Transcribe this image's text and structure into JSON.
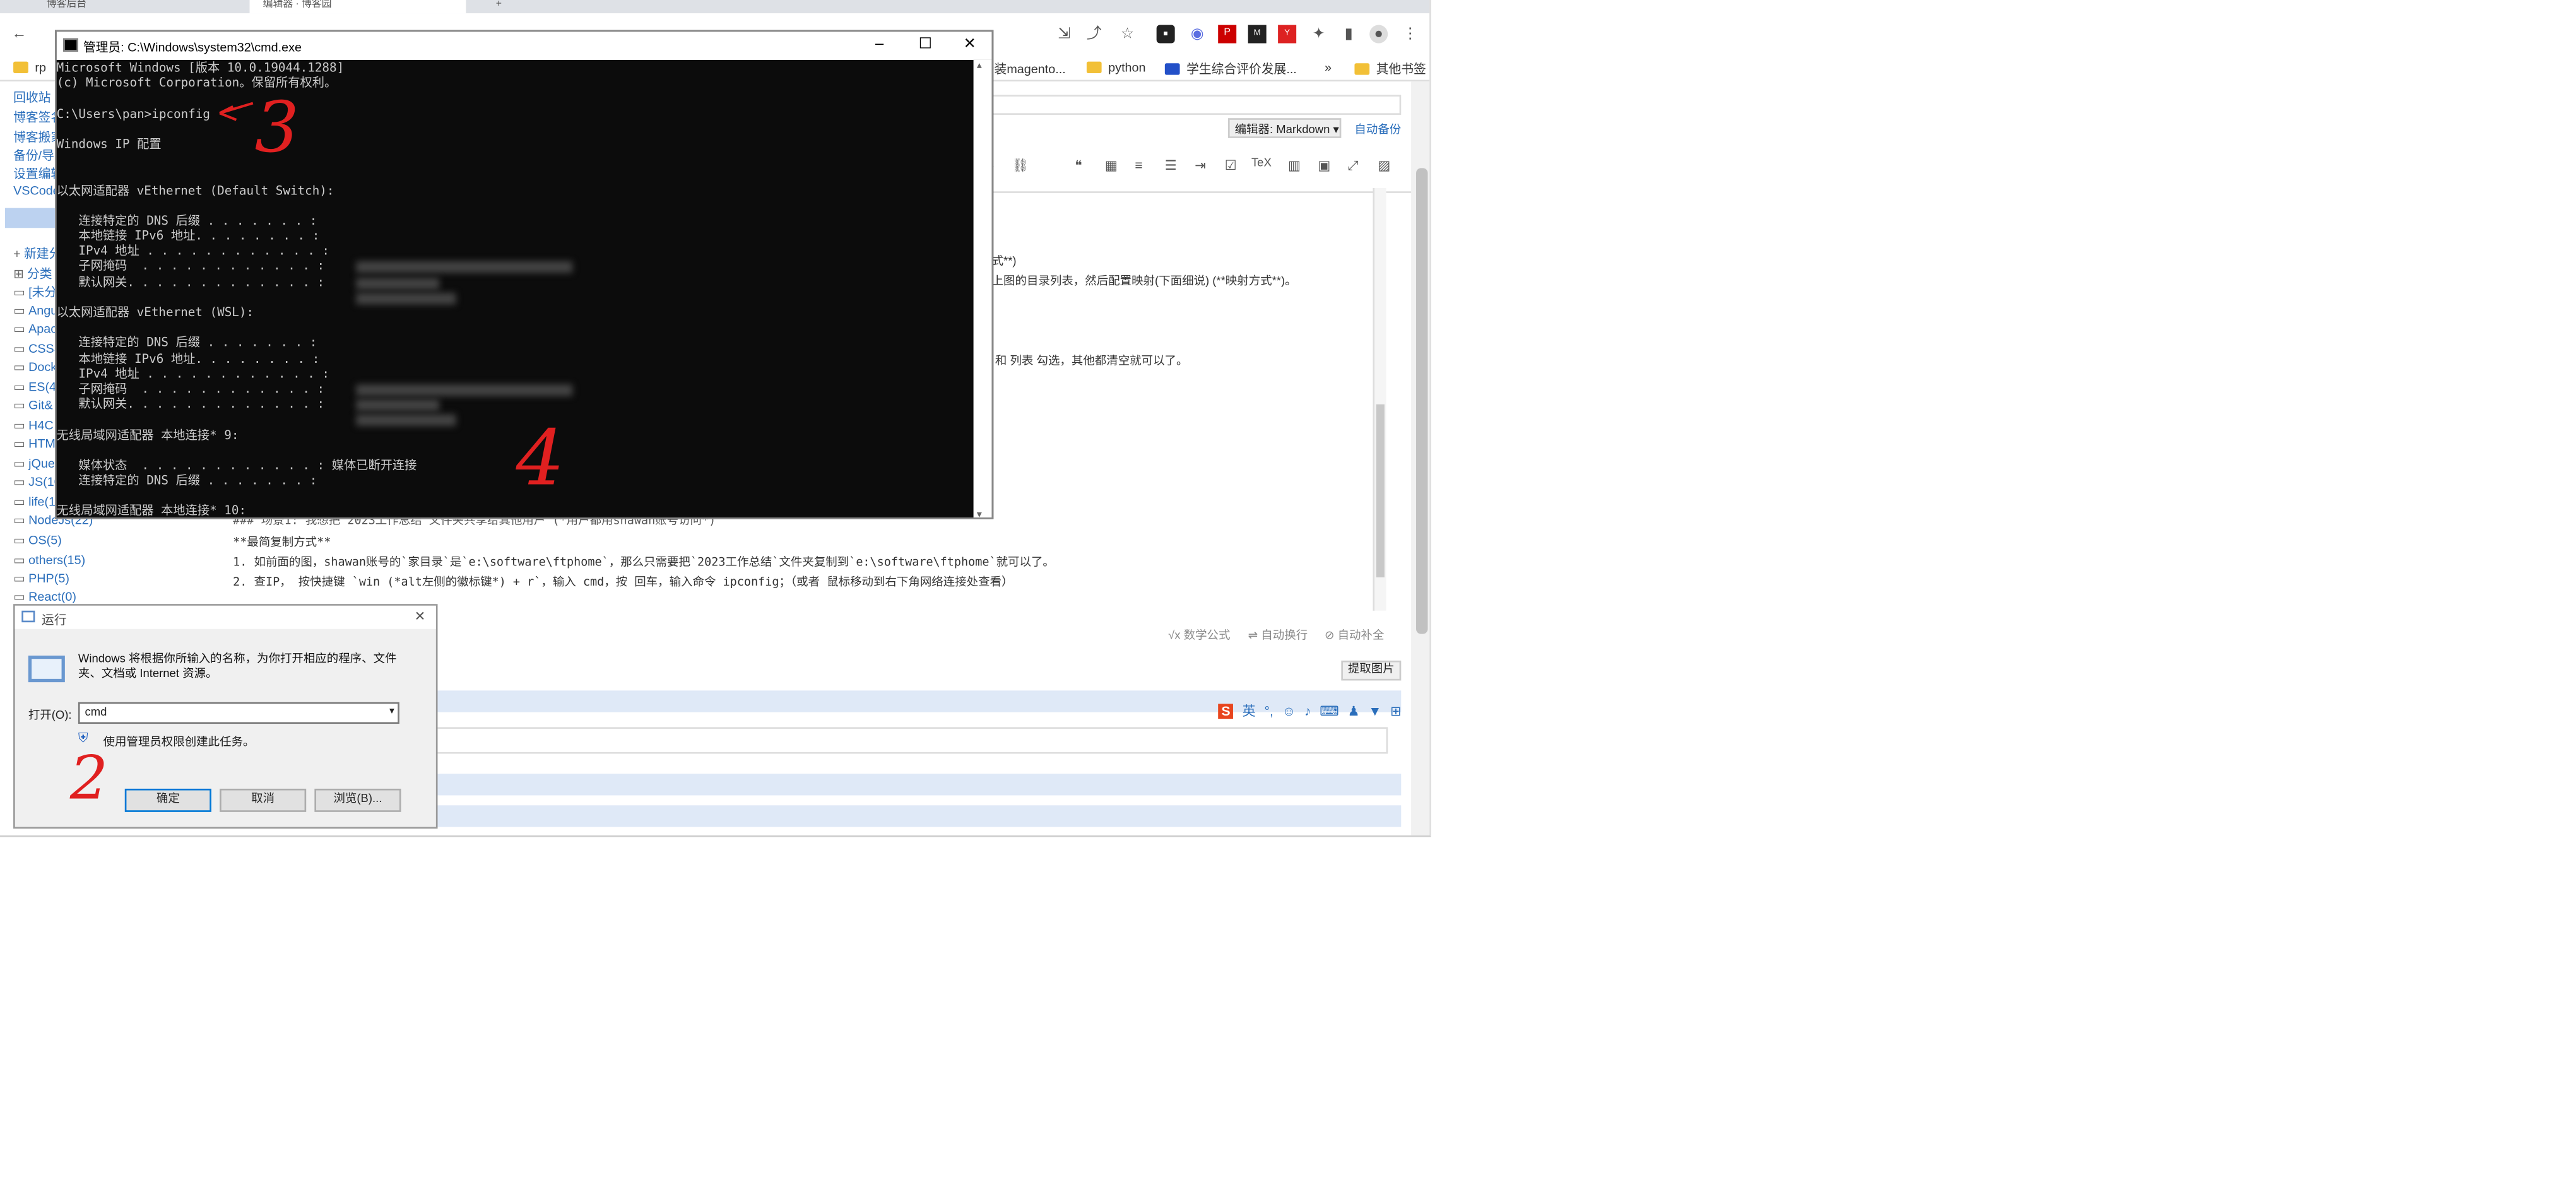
{
  "browser": {
    "tabs": [
      "博客后台",
      "编辑器 · 博客园"
    ],
    "bookmarks": [
      "安装magento...",
      "python",
      "学生综合评价发展...",
      "其他书签"
    ],
    "bookmark_overflow": "»",
    "toolbar_left": "rp"
  },
  "sidebar": {
    "links": [
      "回收站",
      "博客签名",
      "博客搬家",
      "备份/导出",
      "设置编辑",
      "VSCode"
    ],
    "new_category": "新建分类",
    "category_header": "分类",
    "categories": [
      "[未分类]",
      "Angular",
      "Apache",
      "CSS3",
      "Docker",
      "ES(4)",
      "Git&",
      "H4C",
      "HTML",
      "jQuery",
      "JS(10)",
      "life(1)",
      "NodeJs(22)",
      "OS(5)",
      "others(15)",
      "PHP(5)",
      "React(0)"
    ]
  },
  "editor": {
    "editor_label": "编辑器: Markdown",
    "auto_backup": "自动备份",
    "snippet_1": "式**)",
    "snippet_2": "上图的目录列表，然后配置映射(下面细说) (**映射方式**)。",
    "snippet_3": "和 列表 勾选，其他都清空就可以了。",
    "line_1": "### 场景1: 我想把 2023工作总结 文件夹共享给其他用户 (*用户都用shawan账号访问*)",
    "line_2": "**最简复制方式**",
    "line_3": "1. 如前面的图，shawan账号的`家目录`是`e:\\software\\ftphome`，那么只需要把`2023工作总结`文件夹复制到`e:\\software\\ftphome`就可以了。",
    "line_4": "2. 查IP，  按快捷键 `win (*alt左侧的徽标键*) + r`，输入 cmd，按 回车，输入命令 ipconfig；（或者 鼠标移动到右下角网络连接处查看）",
    "math": "数学公式",
    "autowrap": "自动换行",
    "autocomplete": "自动补全",
    "extract_images": "提取图片",
    "ime_label": "英"
  },
  "cmd": {
    "title": "管理员: C:\\Windows\\system32\\cmd.exe",
    "lines": [
      "Microsoft Windows [版本 10.0.19044.1288]",
      "(c) Microsoft Corporation。保留所有权利。",
      "",
      "C:\\Users\\pan>ipconfig",
      "",
      "Windows IP 配置",
      "",
      "",
      "以太网适配器 vEthernet (Default Switch):",
      "",
      "   连接特定的 DNS 后缀 . . . . . . . :",
      "   本地链接 IPv6 地址. . . . . . . . :",
      "   IPv4 地址 . . . . . . . . . . . . :",
      "   子网掩码  . . . . . . . . . . . . :",
      "   默认网关. . . . . . . . . . . . . :",
      "",
      "以太网适配器 vEthernet (WSL):",
      "",
      "   连接特定的 DNS 后缀 . . . . . . . :",
      "   本地链接 IPv6 地址. . . . . . . . :",
      "   IPv4 地址 . . . . . . . . . . . . :",
      "   子网掩码  . . . . . . . . . . . . :",
      "   默认网关. . . . . . . . . . . . . :",
      "",
      "无线局域网适配器 本地连接* 9:",
      "",
      "   媒体状态  . . . . . . . . . . . . : 媒体已断开连接",
      "   连接特定的 DNS 后缀 . . . . . . . :",
      "",
      "无线局域网适配器 本地连接* 10:"
    ]
  },
  "run": {
    "title": "运行",
    "description": "Windows 将根据你所输入的名称，为你打开相应的程序、文件夹、文档或 Internet 资源。",
    "open_label": "打开(O):",
    "input_value": "cmd",
    "admin_note": "使用管理员权限创建此任务。",
    "ok": "确定",
    "cancel": "取消",
    "browse": "浏览(B)..."
  },
  "annotations": [
    "2",
    "3",
    "4"
  ],
  "colors": {
    "annotation": "#e02020",
    "cmd_bg": "#0c0c0c",
    "link": "#2a6ebb"
  }
}
